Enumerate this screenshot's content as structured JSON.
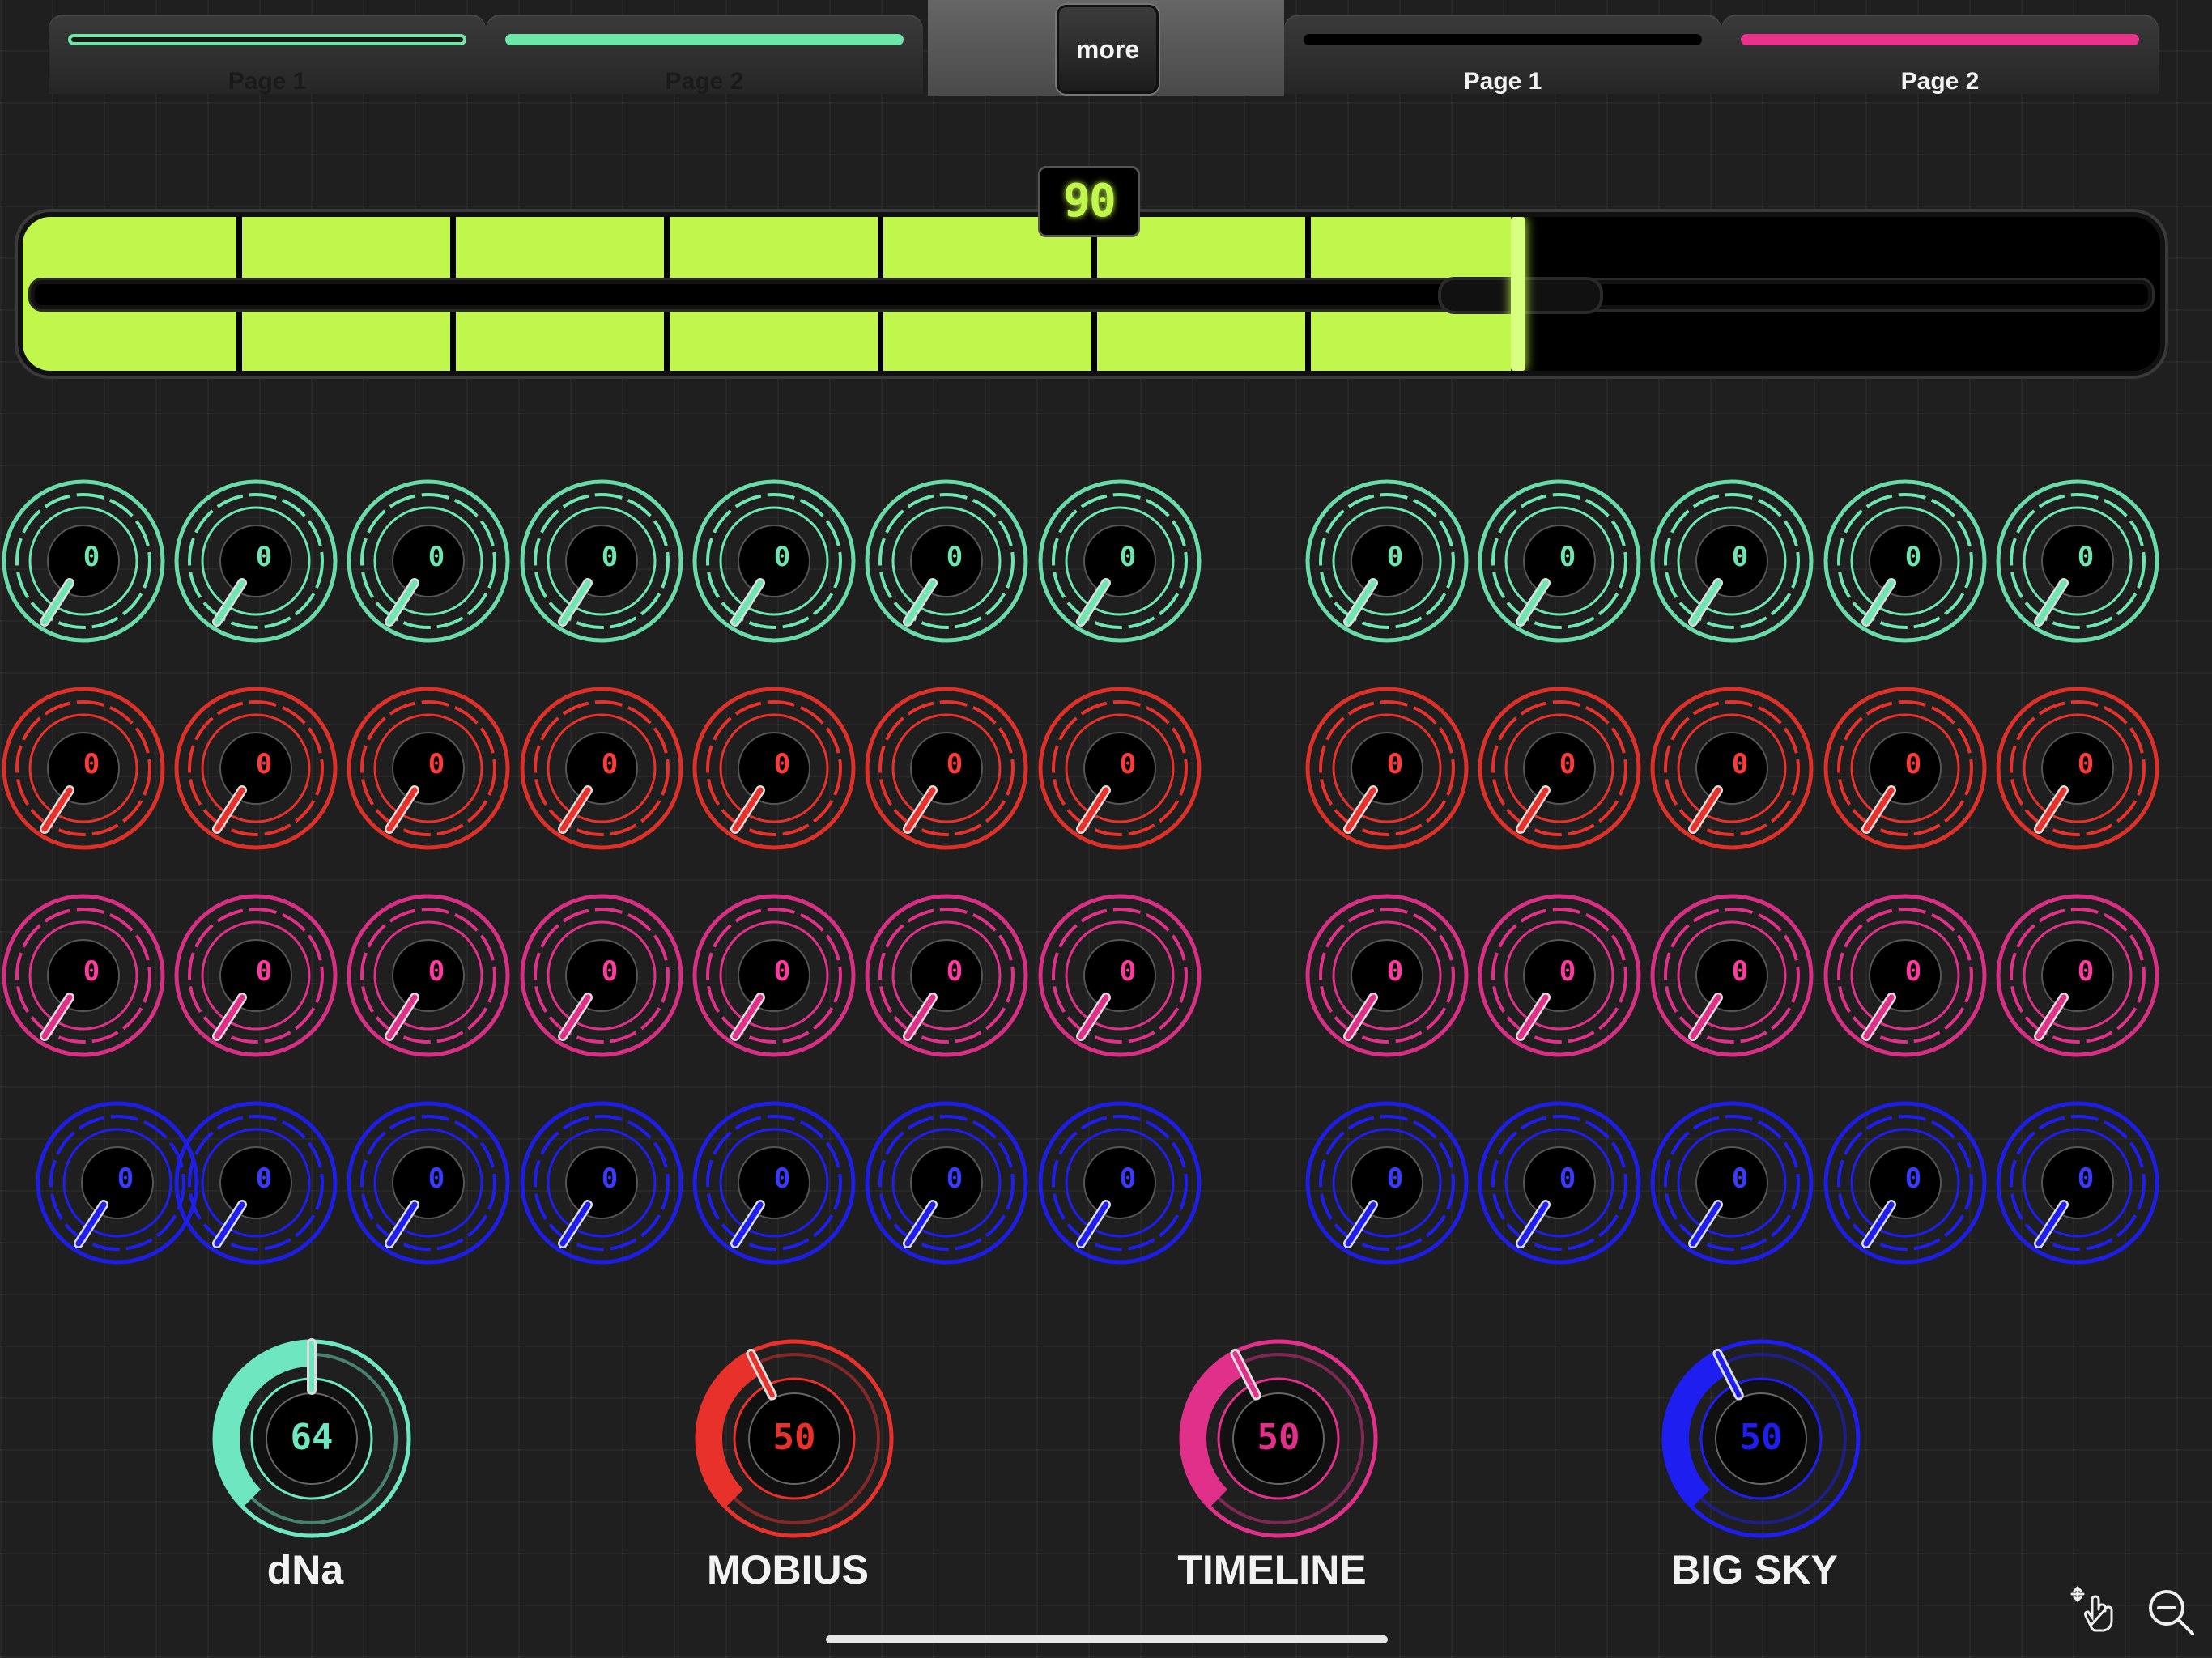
{
  "tabs": [
    {
      "label": "Page 1",
      "color": "#6ee6a8",
      "state": "dim"
    },
    {
      "label": "Page 2",
      "color": "#6ee6a8",
      "state": "dim"
    },
    {
      "label": "Page 1",
      "color": "#000000",
      "state": "lit"
    },
    {
      "label": "Page 2",
      "color": "#e8338a",
      "state": "lit"
    }
  ],
  "more_label": "more",
  "slider": {
    "value": "90",
    "level_percent": 70,
    "color": "#c1f74d",
    "segments": 10
  },
  "knob_rows": [
    {
      "color": "#6ee6b0",
      "value_color": "#6ee6b0",
      "values": [
        "0",
        "0",
        "0",
        "0",
        "0",
        "0",
        "0",
        "0",
        "0",
        "0",
        "0",
        "0"
      ]
    },
    {
      "color": "#e8312a",
      "value_color": "#ff3a3a",
      "values": [
        "0",
        "0",
        "0",
        "0",
        "0",
        "0",
        "0",
        "0",
        "0",
        "0",
        "0",
        "0"
      ]
    },
    {
      "color": "#e0308a",
      "value_color": "#ff3aa0",
      "values": [
        "0",
        "0",
        "0",
        "0",
        "0",
        "0",
        "0",
        "0",
        "0",
        "0",
        "0",
        "0"
      ]
    },
    {
      "color": "#1e1ef0",
      "value_color": "#3a3aff",
      "values": [
        "0",
        "0",
        "0",
        "0",
        "0",
        "0",
        "0",
        "0",
        "0",
        "0",
        "0",
        "0"
      ]
    }
  ],
  "master_knobs": [
    {
      "label": "dNa",
      "value": "64",
      "color": "#6ee6c0",
      "level": 0.5
    },
    {
      "label": "MOBIUS",
      "value": "50",
      "color": "#e8312a",
      "level": 0.4
    },
    {
      "label": "TIMELINE",
      "value": "50",
      "color": "#e0308a",
      "level": 0.4
    },
    {
      "label": "BIG SKY",
      "value": "50",
      "color": "#1e1ef0",
      "level": 0.4
    }
  ],
  "icons": {
    "hand": "hand-move-icon",
    "zoom": "zoom-out-icon"
  }
}
